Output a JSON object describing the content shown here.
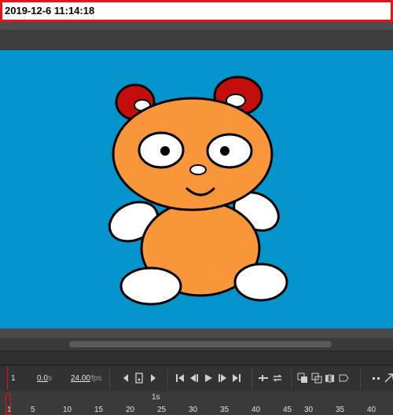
{
  "timestamp": "2019-12-6  11:14:18",
  "colors": {
    "stage": "#0394cc",
    "bear_body": "#f9963a",
    "ears": "#c40d0d",
    "stamp_border": "#e8121c"
  },
  "timeline": {
    "current_frame": "1",
    "time_value": "0.0",
    "time_unit": "s",
    "fps_value": "24.00",
    "fps_unit": "fps",
    "ruler_second_label": "1s",
    "ruler_labels": [
      "1",
      "5",
      "10",
      "15",
      "20",
      "25",
      "30",
      "35",
      "40",
      "45",
      "30",
      "35",
      "40"
    ]
  },
  "icons": {
    "prev": "triangle-left-icon",
    "keyframe": "keyframe-icon",
    "next": "triangle-right-icon",
    "first": "first-frame-icon",
    "step_back": "step-back-icon",
    "play": "play-icon",
    "step_forward": "step-forward-icon",
    "last": "last-frame-icon",
    "loop": "loop-icon",
    "loop2": "loop-range-icon",
    "onion": "onion-skin-icon",
    "onion_outline": "onion-outline-icon",
    "edit_multiple": "edit-multiple-frames-icon",
    "marker": "marker-icon"
  }
}
